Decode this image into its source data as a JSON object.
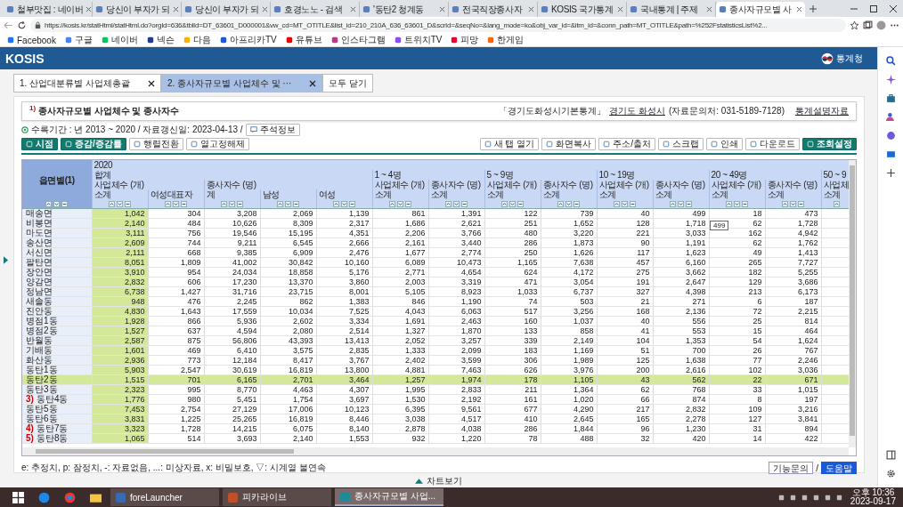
{
  "browser": {
    "tabs": [
      {
        "title": "철부맛집 : 네이버",
        "selected": false
      },
      {
        "title": "당신이 부자가 되",
        "selected": false
      },
      {
        "title": "당신이 부자가 되",
        "selected": false
      },
      {
        "title": "호경노노 - 검색",
        "selected": false
      },
      {
        "title": "'동탄2 청계동",
        "selected": false
      },
      {
        "title": "전국직장종사자",
        "selected": false
      },
      {
        "title": "KOSIS 국가통계",
        "selected": false
      },
      {
        "title": "국내통계 | 주제",
        "selected": false
      },
      {
        "title": "종사자규모별 사",
        "selected": true
      }
    ],
    "url": "https://kosis.kr/statHtml/statHtml.do?orgId=636&tblId=DT_63601_D000001&vw_cd=MT_OTITLE&list_id=210_210A_636_63601_D&scrId=&seqNo=&lang_mode=ko&obj_var_id=&itm_id=&conn_path=MT_OTITLE&path=%252FstatisticsList%2...",
    "bookmarks": [
      "Facebook",
      "구글",
      "네이버",
      "넥슨",
      "다음",
      "아프리카TV",
      "유튜브",
      "인스타그램",
      "트위치TV",
      "피망",
      "한게임"
    ]
  },
  "site": {
    "logo": "KOSIS",
    "agency": "통계청"
  },
  "content_tabs": [
    {
      "label": "1. 산업대분류별 사업체총괄",
      "selected": false,
      "closable": true
    },
    {
      "label": "2. 종사자규모별 사업체수 및 ···",
      "selected": true,
      "closable": true
    },
    {
      "label": "모두 닫기",
      "selected": false,
      "closable": false
    }
  ],
  "heading": {
    "note": "1)",
    "title": "종사자규모별 사업체수 및 종사자수",
    "source": "「경기도화성시기본통계」",
    "org": "경기도 화성시",
    "contact": "(자료문의처: 031-5189-7128)",
    "doc_link": "통계설명자료"
  },
  "info": {
    "text": "수록기간 : 년 2013 ~ 2020 / 자료갱신일: 2023-04-13 /",
    "notes_button": "주석정보"
  },
  "toolbar": {
    "left": [
      {
        "label": "시점",
        "kind": "primary"
      },
      {
        "label": "증감/증감률",
        "kind": "primary"
      },
      {
        "label": "행렬전환",
        "kind": "plain"
      },
      {
        "label": "열고정해제",
        "kind": "plain"
      }
    ],
    "right": [
      {
        "label": "새 탭 열기",
        "kind": "plain"
      },
      {
        "label": "화면복사",
        "kind": "plain"
      },
      {
        "label": "주소/출처",
        "kind": "plain"
      },
      {
        "label": "스크랩",
        "kind": "plain"
      },
      {
        "label": "인쇄",
        "kind": "plain"
      },
      {
        "label": "다운로드",
        "kind": "plain"
      },
      {
        "label": "조회설정",
        "kind": "primary"
      }
    ]
  },
  "table": {
    "corner": "읍면별(1)",
    "year": "2020",
    "groups": [
      {
        "label": "합계",
        "measures": [
          {
            "label": "사업체수 (개)",
            "subs": [
              "소계",
              "여성대표자"
            ]
          },
          {
            "label": "종사자수 (명)",
            "subs": [
              "계",
              "남성",
              "여성"
            ]
          }
        ]
      },
      {
        "label": "1 ~ 4명",
        "measures": [
          {
            "label": "사업체수 (개)",
            "subs": [
              "소계"
            ]
          },
          {
            "label": "종사자수 (명)",
            "subs": [
              "소계"
            ]
          }
        ]
      },
      {
        "label": "5 ~ 9명",
        "measures": [
          {
            "label": "사업체수 (개)",
            "subs": [
              "소계"
            ]
          },
          {
            "label": "종사자수 (명)",
            "subs": [
              "소계"
            ]
          }
        ]
      },
      {
        "label": "10 ~ 19명",
        "measures": [
          {
            "label": "사업체수 (개)",
            "subs": [
              "소계"
            ]
          },
          {
            "label": "종사자수 (명)",
            "subs": [
              "소계"
            ]
          }
        ]
      },
      {
        "label": "20 ~ 49명",
        "measures": [
          {
            "label": "사업체수 (개)",
            "subs": [
              "소계"
            ]
          },
          {
            "label": "종사자수 (명)",
            "subs": [
              "소계"
            ]
          }
        ]
      },
      {
        "label": "50 ~ 9",
        "measures": [
          {
            "label": "사업체",
            "subs": [
              "소계"
            ]
          }
        ]
      }
    ],
    "rows": [
      {
        "name": "매송면",
        "selected": false,
        "values": [
          "1,042",
          "304",
          "3,208",
          "2,069",
          "1,139",
          "861",
          "1,391",
          "122",
          "739",
          "40",
          "499",
          "18",
          "473"
        ]
      },
      {
        "name": "비봉면",
        "selected": false,
        "values": [
          "2,140",
          "484",
          "10,626",
          "8,309",
          "2,317",
          "1,686",
          "2,621",
          "251",
          "1,652",
          "128",
          "1,718",
          "62",
          "1,728"
        ]
      },
      {
        "name": "마도면",
        "selected": false,
        "values": [
          "3,111",
          "756",
          "19,546",
          "15,195",
          "4,351",
          "2,206",
          "3,766",
          "480",
          "3,220",
          "221",
          "3,033",
          "162",
          "4,942"
        ]
      },
      {
        "name": "송산면",
        "selected": false,
        "values": [
          "2,609",
          "744",
          "9,211",
          "6,545",
          "2,666",
          "2,161",
          "3,440",
          "286",
          "1,873",
          "90",
          "1,191",
          "62",
          "1,762"
        ]
      },
      {
        "name": "서신면",
        "selected": false,
        "values": [
          "2,111",
          "668",
          "9,385",
          "6,909",
          "2,476",
          "1,677",
          "2,774",
          "250",
          "1,626",
          "117",
          "1,623",
          "49",
          "1,413"
        ]
      },
      {
        "name": "팔탄면",
        "selected": false,
        "values": [
          "8,051",
          "1,809",
          "41,002",
          "30,842",
          "10,160",
          "6,089",
          "10,473",
          "1,165",
          "7,638",
          "457",
          "6,160",
          "265",
          "7,727"
        ]
      },
      {
        "name": "장안면",
        "selected": false,
        "values": [
          "3,910",
          "954",
          "24,034",
          "18,858",
          "5,176",
          "2,771",
          "4,654",
          "624",
          "4,172",
          "275",
          "3,662",
          "182",
          "5,255"
        ]
      },
      {
        "name": "양감면",
        "selected": false,
        "values": [
          "2,832",
          "606",
          "17,230",
          "13,370",
          "3,860",
          "2,003",
          "3,319",
          "471",
          "3,054",
          "191",
          "2,647",
          "129",
          "3,686"
        ]
      },
      {
        "name": "정남면",
        "selected": false,
        "values": [
          "6,738",
          "1,427",
          "31,716",
          "23,715",
          "8,001",
          "5,105",
          "8,923",
          "1,033",
          "6,737",
          "327",
          "4,398",
          "213",
          "6,173"
        ]
      },
      {
        "name": "새솔동",
        "selected": false,
        "values": [
          "948",
          "476",
          "2,245",
          "862",
          "1,383",
          "846",
          "1,190",
          "74",
          "503",
          "21",
          "271",
          "6",
          "187"
        ]
      },
      {
        "name": "진안동",
        "selected": false,
        "values": [
          "4,830",
          "1,643",
          "17,559",
          "10,034",
          "7,525",
          "4,043",
          "6,063",
          "517",
          "3,256",
          "168",
          "2,136",
          "72",
          "2,215"
        ]
      },
      {
        "name": "병점1동",
        "selected": false,
        "values": [
          "1,928",
          "866",
          "5,936",
          "2,602",
          "3,334",
          "1,691",
          "2,463",
          "160",
          "1,037",
          "40",
          "556",
          "25",
          "814"
        ]
      },
      {
        "name": "병점2동",
        "selected": false,
        "values": [
          "1,527",
          "637",
          "4,594",
          "2,080",
          "2,514",
          "1,327",
          "1,870",
          "133",
          "858",
          "41",
          "553",
          "15",
          "464"
        ]
      },
      {
        "name": "반월동",
        "selected": false,
        "values": [
          "2,587",
          "875",
          "56,806",
          "43,393",
          "13,413",
          "2,052",
          "3,257",
          "339",
          "2,149",
          "104",
          "1,353",
          "54",
          "1,624"
        ]
      },
      {
        "name": "기배동",
        "selected": false,
        "values": [
          "1,601",
          "469",
          "6,410",
          "3,575",
          "2,835",
          "1,333",
          "2,099",
          "183",
          "1,169",
          "51",
          "700",
          "26",
          "767"
        ]
      },
      {
        "name": "화산동",
        "selected": false,
        "values": [
          "2,936",
          "773",
          "12,184",
          "8,417",
          "3,767",
          "2,402",
          "3,599",
          "306",
          "1,989",
          "125",
          "1,638",
          "77",
          "2,246"
        ]
      },
      {
        "name": "동탄1동",
        "selected": false,
        "values": [
          "5,903",
          "2,547",
          "30,619",
          "16,819",
          "13,800",
          "4,881",
          "7,463",
          "626",
          "3,976",
          "200",
          "2,616",
          "102",
          "3,036"
        ]
      },
      {
        "name": "동탄2동",
        "selected": true,
        "values": [
          "1,515",
          "701",
          "6,165",
          "2,701",
          "3,464",
          "1,257",
          "1,974",
          "178",
          "1,105",
          "43",
          "562",
          "22",
          "671"
        ]
      },
      {
        "name": "동탄3동",
        "selected": false,
        "values": [
          "2,323",
          "995",
          "8,770",
          "4,463",
          "4,307",
          "1,995",
          "2,833",
          "211",
          "1,364",
          "62",
          "768",
          "33",
          "1,015"
        ]
      },
      {
        "note": "3)",
        "name": "동탄4동",
        "selected": false,
        "values": [
          "1,776",
          "980",
          "5,451",
          "1,754",
          "3,697",
          "1,530",
          "2,192",
          "161",
          "1,020",
          "66",
          "874",
          "8",
          "197"
        ]
      },
      {
        "name": "동탄5동",
        "selected": false,
        "values": [
          "7,453",
          "2,754",
          "27,129",
          "17,006",
          "10,123",
          "6,395",
          "9,561",
          "677",
          "4,290",
          "217",
          "2,832",
          "109",
          "3,216"
        ]
      },
      {
        "name": "동탄6동",
        "selected": false,
        "values": [
          "3,831",
          "1,225",
          "25,265",
          "16,819",
          "8,446",
          "3,038",
          "4,517",
          "410",
          "2,645",
          "165",
          "2,278",
          "127",
          "3,841"
        ]
      },
      {
        "note": "4)",
        "name": "동탄7동",
        "selected": false,
        "values": [
          "3,323",
          "1,728",
          "14,215",
          "6,075",
          "8,140",
          "2,878",
          "4,038",
          "286",
          "1,844",
          "96",
          "1,230",
          "31",
          "894"
        ]
      },
      {
        "note": "5)",
        "name": "동탄8동",
        "selected": false,
        "values": [
          "1,065",
          "514",
          "3,693",
          "2,140",
          "1,553",
          "932",
          "1,220",
          "78",
          "488",
          "32",
          "420",
          "14",
          "422"
        ]
      }
    ],
    "tooltip": "499"
  },
  "legend": "e: 추정치, p: 잠정치, -: 자료없음, ...: 미상자료, x: 비밀보호, ▽: 시계열 불연속",
  "help": {
    "inquiry": "기능문의",
    "separator": "/",
    "help": "도움말"
  },
  "chart_toggle": "차트보기",
  "taskbar": {
    "apps": [
      "foreLauncher",
      "피카라이브",
      "종사자규모별 사업..."
    ],
    "time": "오후 10:36",
    "date": "2023-09-17"
  }
}
